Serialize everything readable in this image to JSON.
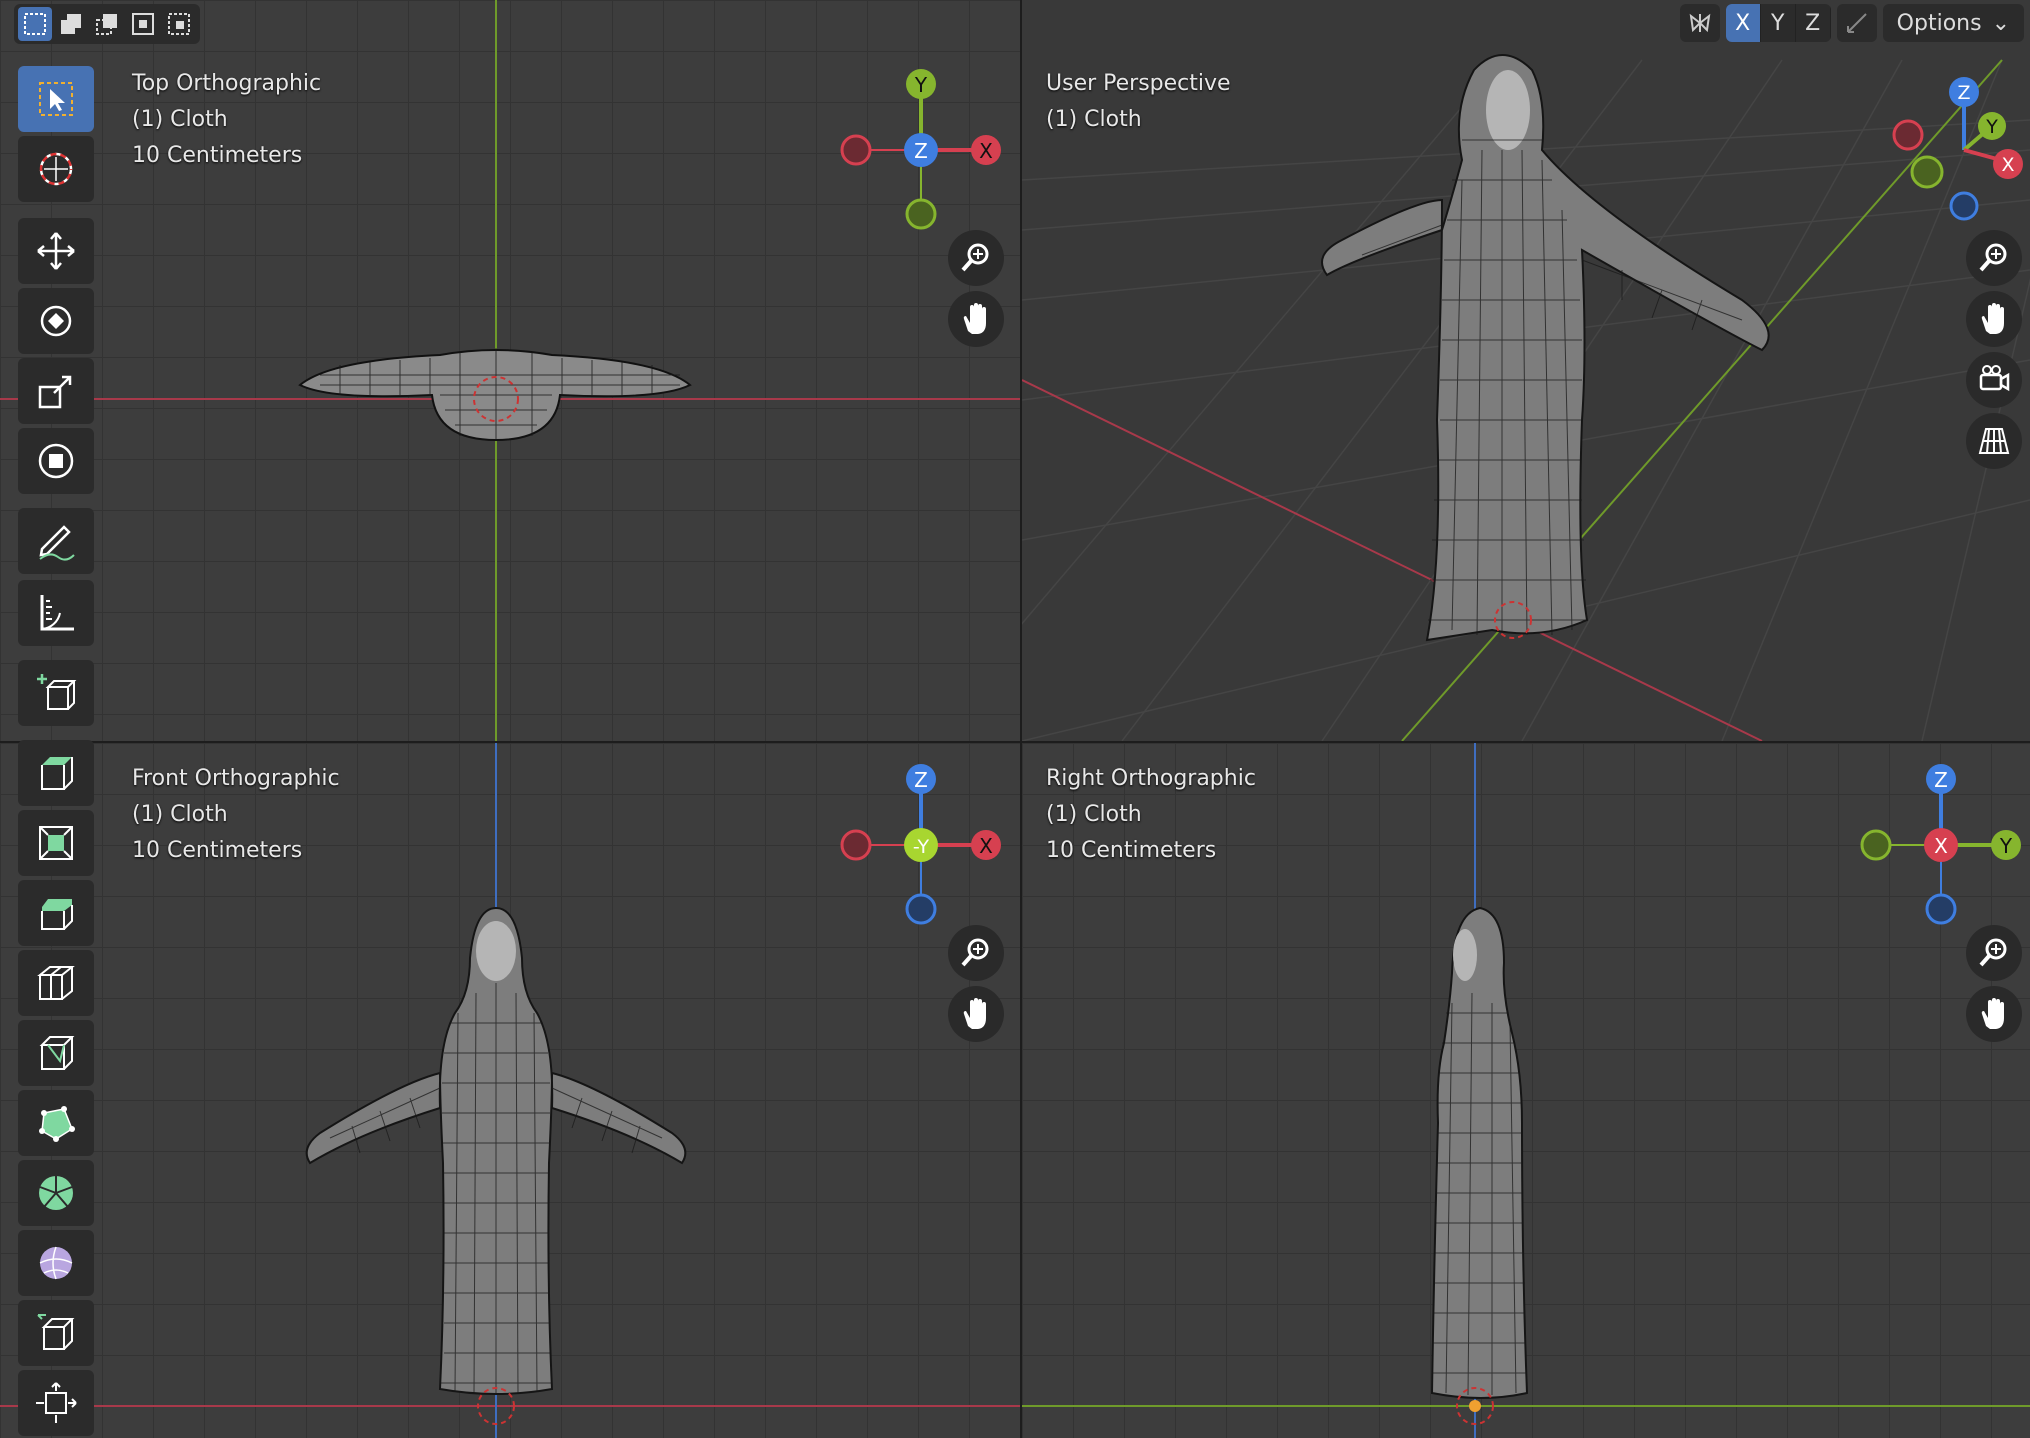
{
  "viewports": [
    {
      "name": "Top Orthographic",
      "object": "(1) Cloth",
      "scale": "10 Centimeters"
    },
    {
      "name": "User Perspective",
      "object": "(1) Cloth"
    },
    {
      "name": "Front Orthographic",
      "object": "(1) Cloth",
      "scale": "10 Centimeters"
    },
    {
      "name": "Right Orthographic",
      "object": "(1) Cloth",
      "scale": "10 Centimeters"
    }
  ],
  "header": {
    "mirror_axes": [
      "X",
      "Y",
      "Z"
    ],
    "options_label": "Options"
  },
  "gizmos": {
    "top": {
      "center": "Z",
      "right": "X",
      "top": "Y"
    },
    "persp": {
      "z": "Z",
      "y": "Y",
      "x": "X"
    },
    "front": {
      "center": "-Y",
      "right": "X",
      "top": "Z"
    },
    "right": {
      "center": "X",
      "right": "Y",
      "top": "Z"
    }
  },
  "colors": {
    "x_axis": "#d64050",
    "y_axis": "#86b52e",
    "z_axis": "#3f7ee0",
    "active": "#4772b3"
  },
  "tools": [
    "select-box-icon",
    "cursor-icon",
    "move-icon",
    "rotate-icon",
    "scale-icon",
    "transform-icon",
    "annotate-icon",
    "measure-icon",
    "add-cube-icon",
    "extrude-icon",
    "inset-icon",
    "bevel-icon",
    "loop-cut-icon",
    "knife-icon",
    "poly-build-icon",
    "spin-icon",
    "smooth-icon",
    "edge-slide-icon",
    "shrink-fatten-icon"
  ]
}
